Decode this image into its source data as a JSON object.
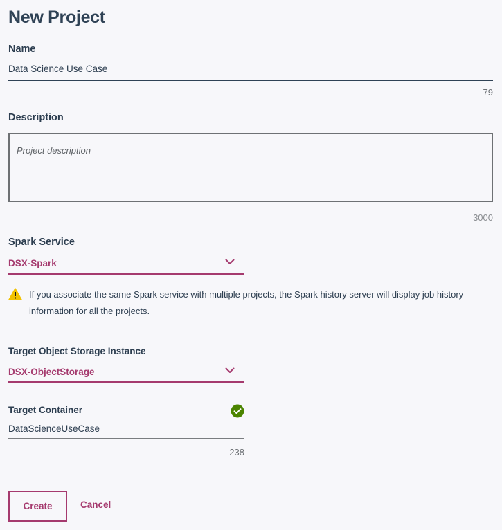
{
  "page": {
    "title": "New Project"
  },
  "name_field": {
    "label": "Name",
    "value": "Data Science Use Case",
    "remaining": "79"
  },
  "description_field": {
    "label": "Description",
    "placeholder": "Project description",
    "remaining": "3000"
  },
  "spark_service": {
    "label": "Spark Service",
    "selected": "DSX-Spark",
    "warning": "If you associate the same Spark service with multiple projects, the Spark history server will display job history information for all the projects."
  },
  "object_storage": {
    "label": "Target Object Storage Instance",
    "selected": "DSX-ObjectStorage"
  },
  "target_container": {
    "label": "Target Container",
    "value": "DataScienceUseCase",
    "remaining": "238"
  },
  "actions": {
    "create_label": "Create",
    "cancel_label": "Cancel"
  },
  "colors": {
    "accent": "#a53a6e",
    "text": "#2d3e50",
    "success": "#4b8400",
    "warning": "#f2c200"
  }
}
